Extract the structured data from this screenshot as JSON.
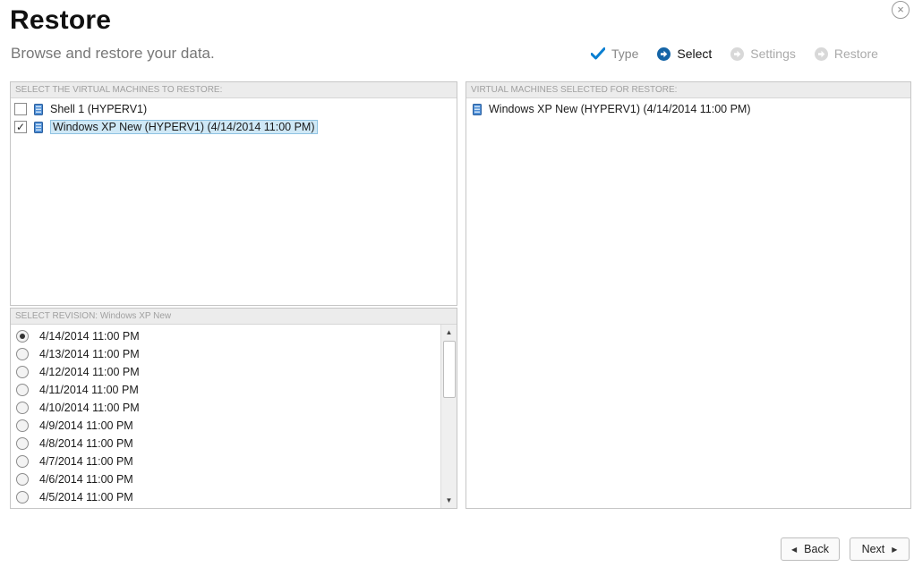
{
  "header": {
    "title": "Restore",
    "subtitle": "Browse and restore your data.",
    "close_symbol": "×"
  },
  "steps": [
    {
      "label": "Type",
      "state": "done",
      "icon": "check-icon"
    },
    {
      "label": "Select",
      "state": "active",
      "icon": "arrow-circle-icon"
    },
    {
      "label": "Settings",
      "state": "future",
      "icon": "arrow-circle-icon"
    },
    {
      "label": "Restore",
      "state": "future",
      "icon": "arrow-circle-icon"
    }
  ],
  "vm_panel": {
    "header": "SELECT THE VIRTUAL MACHINES TO RESTORE:",
    "items": [
      {
        "label": "Shell 1 (HYPERV1)",
        "checked": false
      },
      {
        "label": "Windows XP New (HYPERV1) (4/14/2014 11:00 PM)",
        "checked": true
      }
    ]
  },
  "revision_panel": {
    "header": "SELECT REVISION: Windows XP New",
    "items": [
      {
        "label": "4/14/2014 11:00 PM",
        "selected": true
      },
      {
        "label": "4/13/2014 11:00 PM",
        "selected": false
      },
      {
        "label": "4/12/2014 11:00 PM",
        "selected": false
      },
      {
        "label": "4/11/2014 11:00 PM",
        "selected": false
      },
      {
        "label": "4/10/2014 11:00 PM",
        "selected": false
      },
      {
        "label": "4/9/2014 11:00 PM",
        "selected": false
      },
      {
        "label": "4/8/2014 11:00 PM",
        "selected": false
      },
      {
        "label": "4/7/2014 11:00 PM",
        "selected": false
      },
      {
        "label": "4/6/2014 11:00 PM",
        "selected": false
      },
      {
        "label": "4/5/2014 11:00 PM",
        "selected": false
      }
    ]
  },
  "selected_panel": {
    "header": "VIRTUAL MACHINES SELECTED FOR RESTORE:",
    "items": [
      {
        "label": "Windows XP New (HYPERV1) (4/14/2014 11:00 PM)"
      }
    ]
  },
  "buttons": {
    "back": "Back",
    "next": "Next"
  },
  "colors": {
    "accent": "#0a7fd1",
    "selection": "#cfe8f6"
  }
}
